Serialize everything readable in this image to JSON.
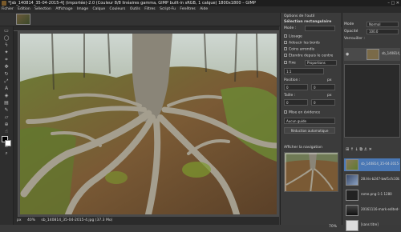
{
  "titlebar": {
    "title": "*[sb_140814_35-04-2015-4] (importée)-2.0 (Couleur 8/8 linéaires gamma, GIMP built-in sRGB, 1 calque) 1800x1800 – GIMP",
    "window_controls": "–  □  ✕"
  },
  "menubar": {
    "items": [
      "Fichier",
      "Édition",
      "Sélection",
      "Affichage",
      "Image",
      "Calque",
      "Couleurs",
      "Outils",
      "Filtres",
      "Script-Fu",
      "Fenêtres",
      "Aide"
    ]
  },
  "statusbar": {
    "unit": "px",
    "zoom": "40%",
    "filename": "sb_140814_35-04-2015-4.jpg (37.3 Mo)"
  },
  "tool_options": {
    "title": "Options de l'outil",
    "subtitle": "Sélection rectangulaire",
    "mode_label": "Mode :",
    "antialias": "Lissage",
    "feather": "Adoucir les bords",
    "rounded": "Coins arrondis",
    "expand_center": "Étendre depuis le centre",
    "fixed_label": "Fixe",
    "fixed_value": "Proportions",
    "ratio": "1:1",
    "position_label": "Position :",
    "position_unit": "px",
    "pos_x": "0",
    "pos_y": "0",
    "size_label": "Taille :",
    "size_unit": "px",
    "size_w": "0",
    "size_h": "0",
    "highlight": "Mise en évidence",
    "guides": "Aucun guide",
    "auto_shrink": "Réduction automatique",
    "navigation_title": "Afficher la navigation",
    "nav_zoom": "70%"
  },
  "layers": {
    "mode_label": "Mode",
    "mode_value": "Normal",
    "opacity_label": "Opacité",
    "opacity_value": "100.0",
    "lock_label": "Verrouiller :",
    "layer_name": "sb_140814_3",
    "images": [
      {
        "name": "sb_140814_35-04-2015-4"
      },
      {
        "name": "28.Iris-b247-bwf1cfc10b"
      },
      {
        "name": "rome.png-1-1 1280"
      },
      {
        "name": "20161116-mark-edited-f"
      },
      {
        "name": "[sans titre]"
      }
    ]
  },
  "colors": {
    "accent": "#5a7a3a",
    "highlight": "#4a78b5"
  }
}
